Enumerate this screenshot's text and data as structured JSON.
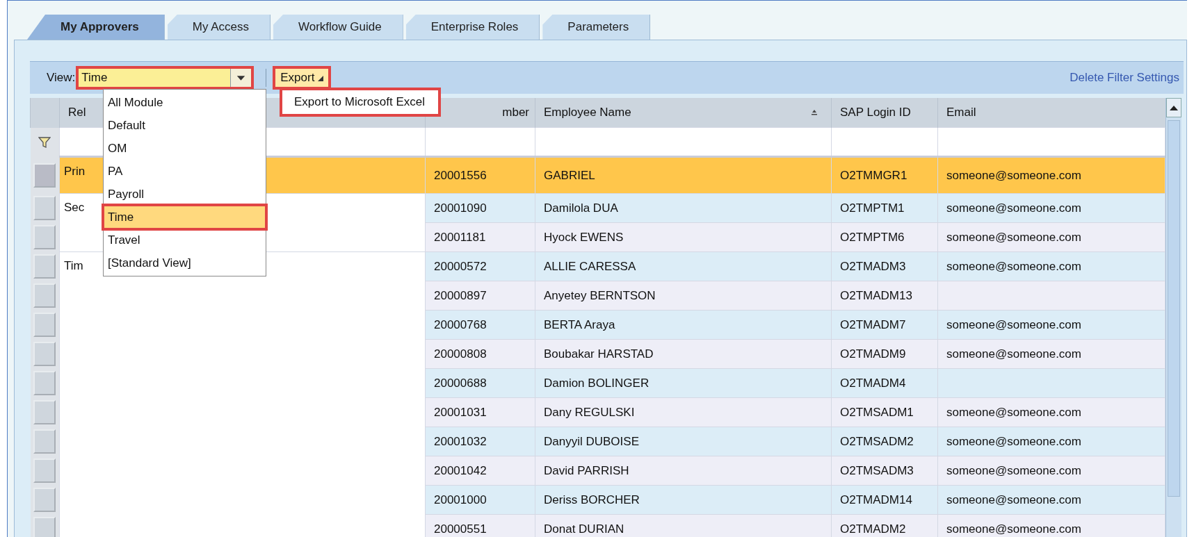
{
  "tabs": [
    {
      "label": "My Approvers",
      "selected": true
    },
    {
      "label": "My Access",
      "selected": false
    },
    {
      "label": "Workflow Guide",
      "selected": false
    },
    {
      "label": "Enterprise Roles",
      "selected": false
    },
    {
      "label": "Parameters",
      "selected": false
    }
  ],
  "toolbar": {
    "view_label": "View:",
    "view_value": "Time",
    "view_marked": true,
    "export_label": "Export",
    "export_marked": true,
    "delete_filter": "Delete Filter Settings"
  },
  "view_menu": {
    "items": [
      {
        "label": "All Module",
        "selected": false
      },
      {
        "label": "Default",
        "selected": false
      },
      {
        "label": "OM",
        "selected": false
      },
      {
        "label": "PA",
        "selected": false
      },
      {
        "label": "Payroll",
        "selected": false
      },
      {
        "label": "Time",
        "selected": true
      },
      {
        "label": "Travel",
        "selected": false
      },
      {
        "label": "[Standard View]",
        "selected": false
      }
    ]
  },
  "export_menu": {
    "items": [
      {
        "label": "Export to Microsoft Excel",
        "marked": true
      }
    ]
  },
  "table": {
    "columns": [
      {
        "label": "Rel",
        "sorted": false
      },
      {
        "label": "mber",
        "sorted": false
      },
      {
        "label": "Employee Name",
        "sorted": true
      },
      {
        "label": "SAP Login ID",
        "sorted": false
      },
      {
        "label": "Email",
        "sorted": false
      }
    ],
    "groups": [
      {
        "relationship": "Prin",
        "rows": [
          {
            "number": "20001556",
            "name": "GABRIEL",
            "login": "O2TMMGR1",
            "email": "someone@someone.com",
            "selected": true
          }
        ]
      },
      {
        "relationship": "Sec",
        "rows": [
          {
            "number": "20001090",
            "name": "Damilola DUA",
            "login": "O2TMPTM1",
            "email": "someone@someone.com",
            "selected": false
          },
          {
            "number": "20001181",
            "name": "Hyock EWENS",
            "login": "O2TMPTM6",
            "email": "someone@someone.com",
            "selected": false
          }
        ]
      },
      {
        "relationship": "Tim",
        "rows": [
          {
            "number": "20000572",
            "name": "ALLIE CARESSA",
            "login": "O2TMADM3",
            "email": "someone@someone.com",
            "selected": false
          },
          {
            "number": "20000897",
            "name": "Anyetey BERNTSON",
            "login": "O2TMADM13",
            "selected": false
          },
          {
            "number": "20000768",
            "name": "BERTA Araya",
            "login": "O2TMADM7",
            "email": "someone@someone.com",
            "selected": false
          },
          {
            "number": "20000808",
            "name": "Boubakar HARSTAD",
            "login": "O2TMADM9",
            "email": "someone@someone.com",
            "selected": false
          },
          {
            "number": "20000688",
            "name": "Damion BOLINGER",
            "login": "O2TMADM4",
            "selected": false
          },
          {
            "number": "20001031",
            "name": "Dany REGULSKI",
            "login": "O2TMSADM1",
            "email": "someone@someone.com",
            "selected": false
          },
          {
            "number": "20001032",
            "name": "Danyyil DUBOISE",
            "login": "O2TMSADM2",
            "email": "someone@someone.com",
            "selected": false
          },
          {
            "number": "20001042",
            "name": "David PARRISH",
            "login": "O2TMSADM3",
            "email": "someone@someone.com",
            "selected": false
          },
          {
            "number": "20001000",
            "name": "Deriss BORCHER",
            "login": "O2TMADM14",
            "email": "someone@someone.com",
            "selected": false
          },
          {
            "number": "20000551",
            "name": "Donat DURIAN",
            "login": "O2TMADM2",
            "email": "someone@someone.com",
            "selected": false
          }
        ]
      }
    ]
  }
}
